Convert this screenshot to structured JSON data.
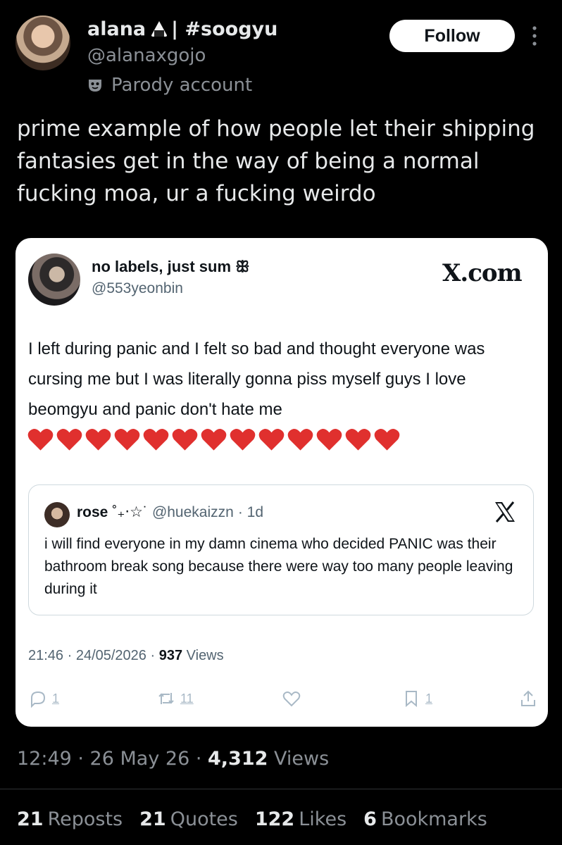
{
  "author": {
    "display_name": "alana",
    "name_suffix": "| #soogyu",
    "handle": "@alanaxgojo",
    "label": "Parody account"
  },
  "follow_label": "Follow",
  "tweet_text": "prime example of how people let their shipping fantasies get in the way of being a normal fucking moa, ur a fucking weirdo",
  "embedded": {
    "name": "no labels, just sum ꕥ",
    "handle": "@553yeonbin",
    "source": "X.com",
    "text": "I left during panic and I felt so bad and thought everyone was cursing me but I was literally gonna piss myself guys I love beomgyu and panic don't hate me",
    "heart_count": 13,
    "quote": {
      "name": "rose",
      "name_deco": "˚₊‧☆˙",
      "handle": "@huekaizzn",
      "age": "· 1d",
      "text": "i will find everyone in my damn cinema who decided PANIC was their bathroom break song because there were way too many people leaving during it"
    },
    "time": "21:46 · 24/05/2026 ·",
    "views_count": "937",
    "views_label": "Views",
    "replies": "1",
    "reposts": "11",
    "bookmarks": "1"
  },
  "meta": {
    "time": "12:49 · 26 May 26 ·",
    "views_count": "4,312",
    "views_label": "Views"
  },
  "stats": [
    {
      "count": "21",
      "label": "Reposts"
    },
    {
      "count": "21",
      "label": "Quotes"
    },
    {
      "count": "122",
      "label": "Likes"
    },
    {
      "count": "6",
      "label": "Bookmarks"
    }
  ],
  "colors": {
    "background": "#000000",
    "card": "#ffffff",
    "heart": "#e0302e",
    "muted": "#8b9096"
  }
}
